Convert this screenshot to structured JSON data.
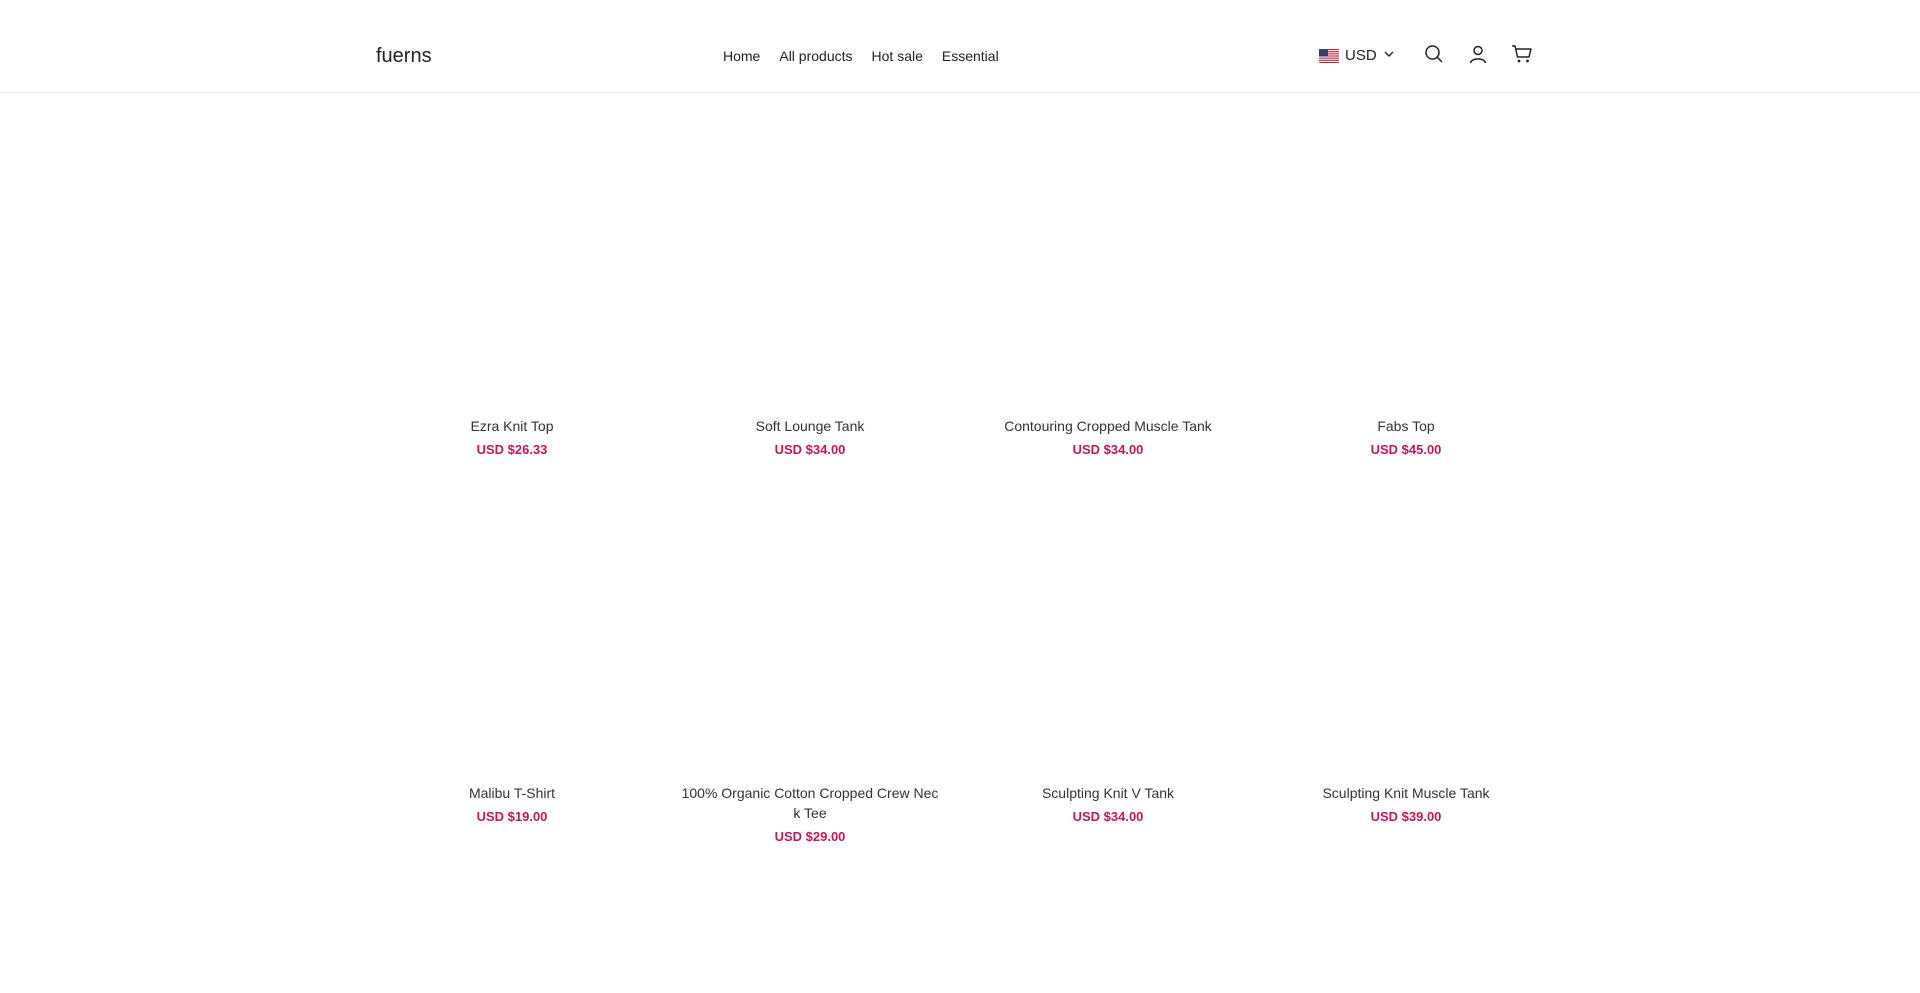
{
  "header": {
    "logo": "fuerns",
    "nav": [
      "Home",
      "All products",
      "Hot sale",
      "Essential"
    ],
    "currency": {
      "code": "USD",
      "flag": "us-flag-icon"
    },
    "icons": [
      "search-icon",
      "account-icon",
      "cart-icon"
    ]
  },
  "products": [
    {
      "title": "Ezra Knit Top",
      "price": "USD $26.33"
    },
    {
      "title": "Soft Lounge Tank",
      "price": "USD $34.00"
    },
    {
      "title": "Contouring Cropped Muscle Tank",
      "price": "USD $34.00"
    },
    {
      "title": "Fabs Top",
      "price": "USD $45.00"
    },
    {
      "title": "Malibu T-Shirt",
      "price": "USD $19.00"
    },
    {
      "title": "100% Organic Cotton Cropped Crew Neck Tee",
      "price": "USD $29.00"
    },
    {
      "title": "Sculpting Knit V Tank",
      "price": "USD $34.00"
    },
    {
      "title": "Sculpting Knit Muscle Tank",
      "price": "USD $39.00"
    }
  ],
  "colors": {
    "price": "#c0185a",
    "text": "#333333",
    "border": "#ededed"
  }
}
